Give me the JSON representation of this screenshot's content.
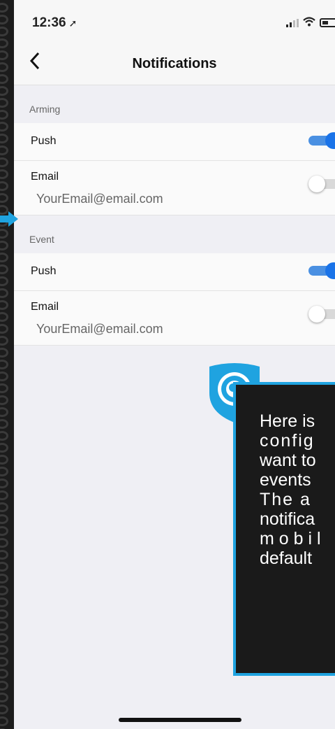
{
  "status_bar": {
    "time": "12:36",
    "location_icon": "location-arrow-icon",
    "icons": [
      "signal-icon",
      "wifi-icon",
      "battery-icon"
    ]
  },
  "nav": {
    "back_icon": "chevron-left-icon",
    "title": "Notifications"
  },
  "sections": [
    {
      "header": "Arming",
      "push": {
        "label": "Push",
        "enabled": true
      },
      "email": {
        "label": "Email",
        "address": "YourEmail@email.com",
        "enabled": false
      }
    },
    {
      "header": "Event",
      "push": {
        "label": "Push",
        "enabled": true
      },
      "email": {
        "label": "Email",
        "address": "YourEmail@email.com",
        "enabled": false
      }
    }
  ],
  "callout": {
    "lines": [
      "Here is",
      "config",
      "want to",
      "events",
      "The a",
      "notifica",
      "m o b i l",
      "default"
    ],
    "badge_icon": "eye-shield-icon",
    "pointer_icon": "arrow-right-icon"
  },
  "colors": {
    "accent": "#1a73e8",
    "callout_border": "#1fa3e0",
    "callout_bg": "#1a1a1a"
  }
}
